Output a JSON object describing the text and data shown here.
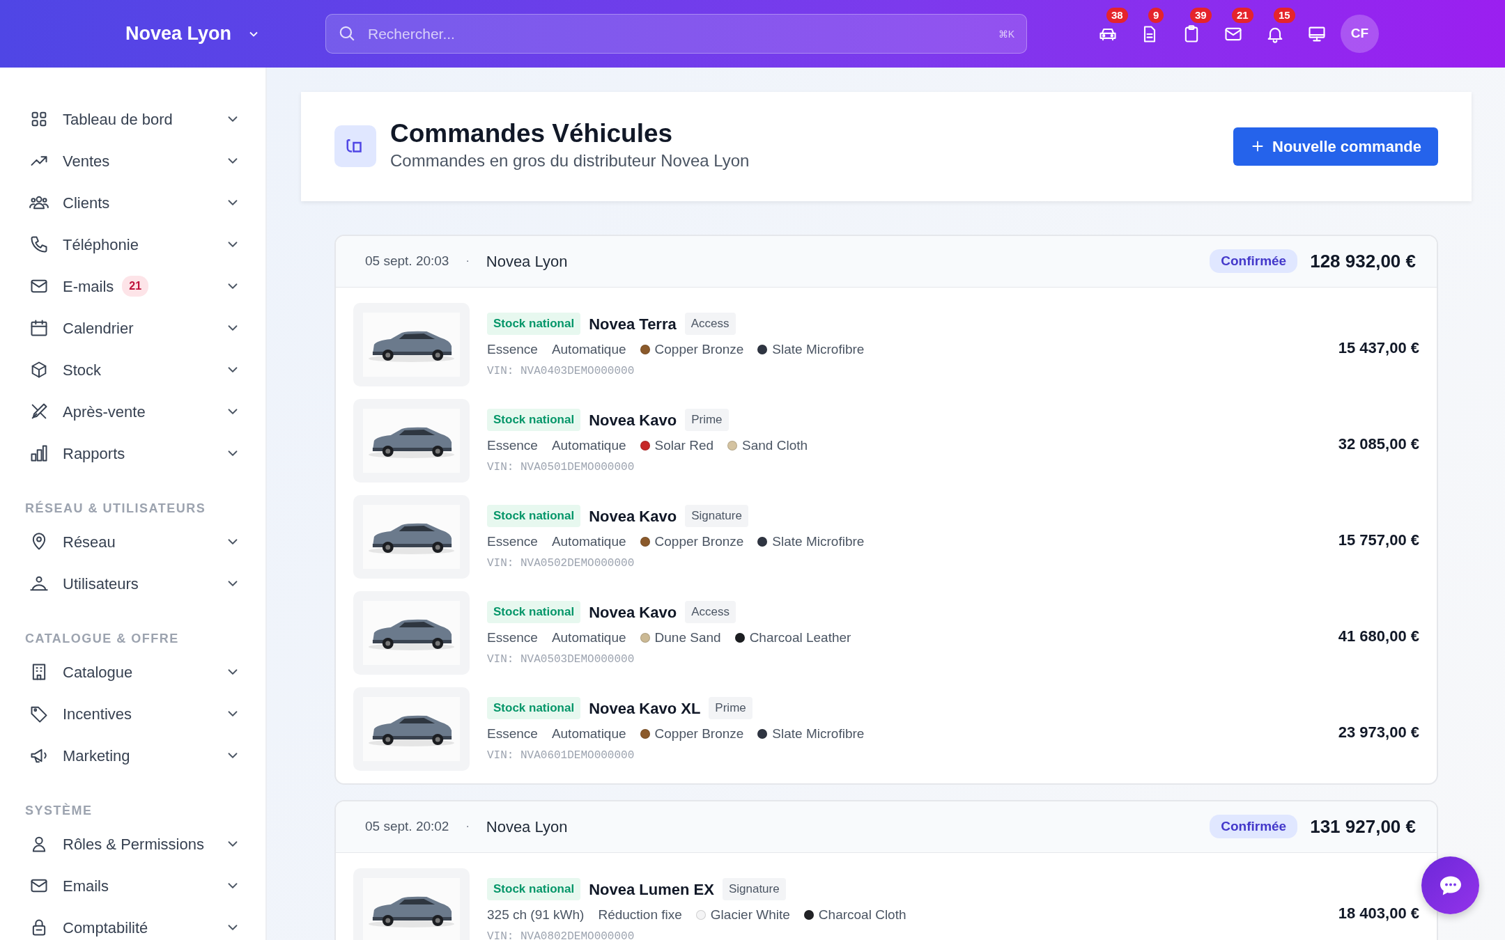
{
  "topbar": {
    "brand": "Novea Lyon",
    "search": {
      "placeholder": "Rechercher...",
      "shortcut": "⌘K"
    },
    "icons": [
      {
        "kind": "car",
        "count": "38"
      },
      {
        "kind": "document",
        "count": "9"
      },
      {
        "kind": "clipboard",
        "count": "39"
      },
      {
        "kind": "mail",
        "count": "21"
      },
      {
        "kind": "bell",
        "count": "15"
      },
      {
        "kind": "monitor"
      }
    ],
    "avatar": "CF"
  },
  "sidebar": {
    "sections": [
      {
        "items": [
          {
            "label": "Tableau de bord"
          },
          {
            "label": "Ventes"
          },
          {
            "label": "Clients"
          },
          {
            "label": "Téléphonie"
          },
          {
            "label": "E-mails",
            "badge": "21"
          },
          {
            "label": "Calendrier"
          },
          {
            "label": "Stock"
          },
          {
            "label": "Après-vente"
          },
          {
            "label": "Rapports"
          }
        ]
      },
      {
        "heading": "RÉSEAU & UTILISATEURS",
        "items": [
          {
            "label": "Réseau"
          },
          {
            "label": "Utilisateurs"
          }
        ]
      },
      {
        "heading": "CATALOGUE & OFFRE",
        "items": [
          {
            "label": "Catalogue"
          },
          {
            "label": "Incentives"
          },
          {
            "label": "Marketing"
          }
        ]
      },
      {
        "heading": "SYSTÈME",
        "items": [
          {
            "label": "Rôles & Permissions"
          },
          {
            "label": "Emails"
          },
          {
            "label": "Comptabilité"
          }
        ]
      }
    ]
  },
  "page": {
    "title": "Commandes Véhicules",
    "subtitle": "Commandes en gros du distributeur Novea Lyon",
    "button": "Nouvelle commande"
  },
  "orders": [
    {
      "date": "05 sept. 20:03",
      "separator": "·",
      "dealer": "Novea Lyon",
      "status": "Confirmée",
      "total": "128 932,00 €",
      "items": [
        {
          "badge": "Stock national",
          "model": "Novea Terra",
          "trim": "Access",
          "specs": [
            "Essence",
            "Automatique"
          ],
          "colors": [
            {
              "name": "Copper Bronze",
              "color": "#8b5a2b"
            },
            {
              "name": "Slate Microfibre",
              "color": "#2f3542"
            }
          ],
          "vin": "VIN: NVA0403DEMO000000",
          "price": "15 437,00 €"
        },
        {
          "badge": "Stock national",
          "model": "Novea Kavo",
          "trim": "Prime",
          "specs": [
            "Essence",
            "Automatique"
          ],
          "colors": [
            {
              "name": "Solar Red",
              "color": "#c62828"
            },
            {
              "name": "Sand Cloth",
              "color": "#d4c3a1"
            }
          ],
          "vin": "VIN: NVA0501DEMO000000",
          "price": "32 085,00 €"
        },
        {
          "badge": "Stock national",
          "model": "Novea Kavo",
          "trim": "Signature",
          "specs": [
            "Essence",
            "Automatique"
          ],
          "colors": [
            {
              "name": "Copper Bronze",
              "color": "#8b5a2b"
            },
            {
              "name": "Slate Microfibre",
              "color": "#2f3542"
            }
          ],
          "vin": "VIN: NVA0502DEMO000000",
          "price": "15 757,00 €"
        },
        {
          "badge": "Stock national",
          "model": "Novea Kavo",
          "trim": "Access",
          "specs": [
            "Essence",
            "Automatique"
          ],
          "colors": [
            {
              "name": "Dune Sand",
              "color": "#cbb994"
            },
            {
              "name": "Charcoal Leather",
              "color": "#1c1e21"
            }
          ],
          "vin": "VIN: NVA0503DEMO000000",
          "price": "41 680,00 €"
        },
        {
          "badge": "Stock national",
          "model": "Novea Kavo XL",
          "trim": "Prime",
          "specs": [
            "Essence",
            "Automatique"
          ],
          "colors": [
            {
              "name": "Copper Bronze",
              "color": "#8b5a2b"
            },
            {
              "name": "Slate Microfibre",
              "color": "#2f3542"
            }
          ],
          "vin": "VIN: NVA0601DEMO000000",
          "price": "23 973,00 €"
        }
      ]
    },
    {
      "date": "05 sept. 20:02",
      "separator": "·",
      "dealer": "Novea Lyon",
      "status": "Confirmée",
      "total": "131 927,00 €",
      "items": [
        {
          "badge": "Stock national",
          "model": "Novea Lumen EX",
          "trim": "Signature",
          "specs": [
            "325 ch (91 kWh)",
            "Réduction fixe"
          ],
          "colors": [
            {
              "name": "Glacier White",
              "color": "#f4f4f5"
            },
            {
              "name": "Charcoal Cloth",
              "color": "#222326"
            }
          ],
          "vin": "VIN: NVA0802DEMO000000",
          "price": "18 403,00 €"
        }
      ]
    }
  ]
}
